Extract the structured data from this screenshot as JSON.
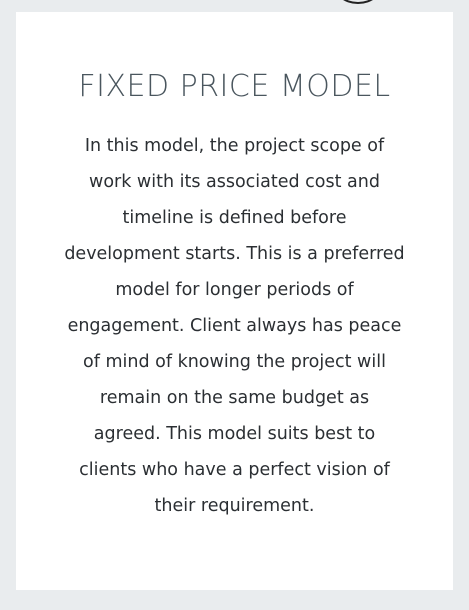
{
  "card": {
    "title": "FIXED PRICE MODEL",
    "body": "In this model, the project scope of\nwork with its associated cost and\ntimeline is defined before\ndevelopment starts. This is a preferred\nmodel for longer periods of\nengagement. Client always has peace\nof mind of knowing the project will\nremain on the same budget as\nagreed. This model suits best to\nclients who have a perfect vision of\ntheir requirement."
  }
}
